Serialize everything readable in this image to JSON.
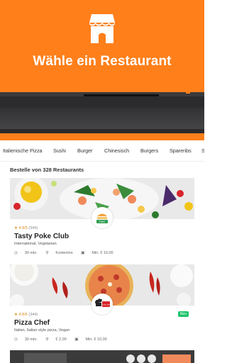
{
  "hero": {
    "title": "Wähle ein Restaurant"
  },
  "categories": [
    "Italienische Pizza",
    "Sushi",
    "Burger",
    "Chinesisch",
    "Burgers",
    "Spareribs",
    "S"
  ],
  "section": {
    "count_label": "Bestelle von 328 Restaurants"
  },
  "restaurants": [
    {
      "rating": "4.8/5",
      "reviews": "(344)",
      "name": "Tasty Poke Club",
      "cuisine": "International, Vegetarian",
      "delivery_time": "30 min.",
      "delivery_cost": "Kostenlos",
      "min_order": "Min. € 10,00",
      "logo_text": "POKE"
    },
    {
      "rating": "4.8/5",
      "reviews": "(344)",
      "name": "Pizza Chef",
      "cuisine": "Italian, Italian style pizza, Vegan",
      "delivery_time": "30 min.",
      "delivery_cost": "€ 2,00",
      "min_order": "Min. € 10,00",
      "badge": "Neu",
      "logo_text": "PIZZA CHEF"
    }
  ],
  "colors": {
    "brand": "#ff7f1a",
    "badge_new": "#1ec36b"
  }
}
